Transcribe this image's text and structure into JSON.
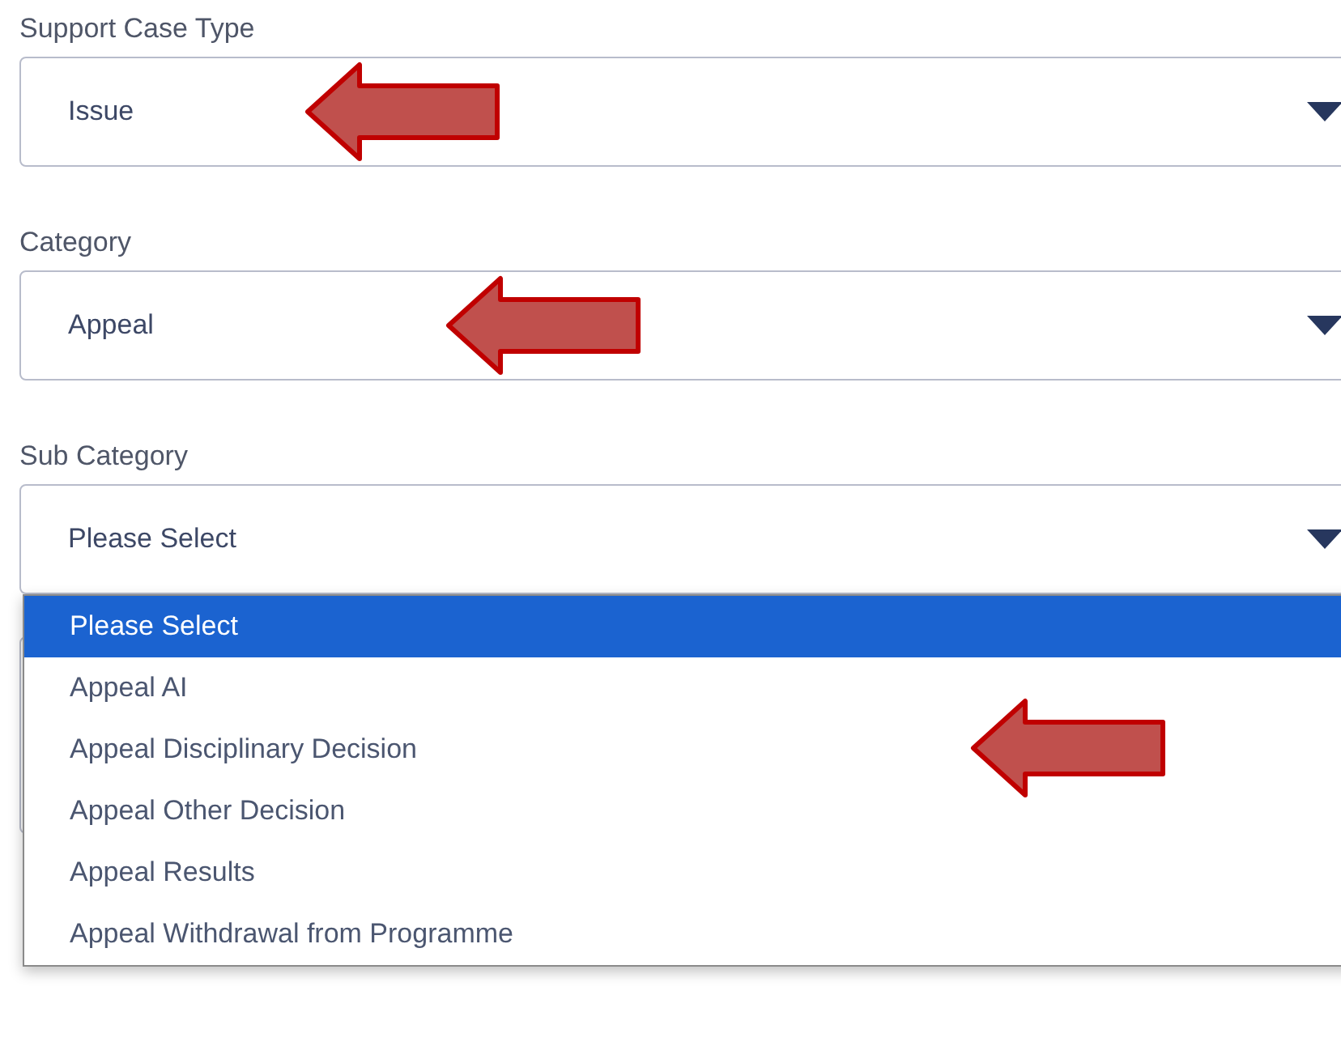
{
  "fields": [
    {
      "label": "Support Case Type",
      "value": "Issue"
    },
    {
      "label": "Category",
      "value": "Appeal"
    },
    {
      "label": "Sub Category",
      "value": "Please Select",
      "options": [
        {
          "label": "Please Select",
          "selected": true
        },
        {
          "label": "Appeal AI",
          "selected": false
        },
        {
          "label": "Appeal Disciplinary Decision",
          "selected": false
        },
        {
          "label": "Appeal Other Decision",
          "selected": false
        },
        {
          "label": "Appeal Results",
          "selected": false
        },
        {
          "label": "Appeal Withdrawal from Programme",
          "selected": false
        }
      ]
    }
  ]
}
